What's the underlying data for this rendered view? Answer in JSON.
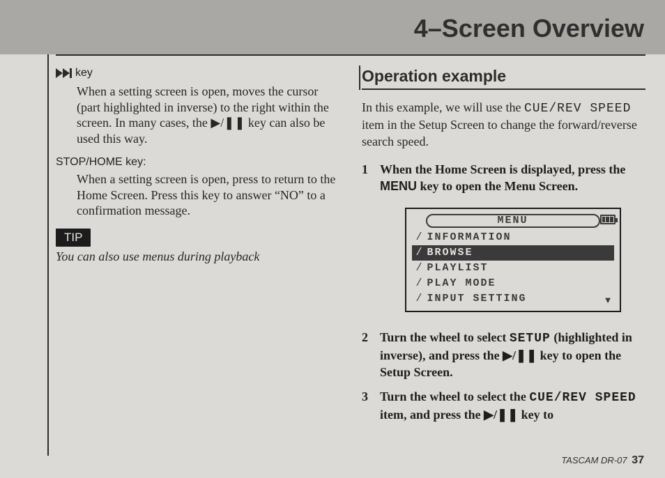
{
  "chapter_title": "4–Screen Overview",
  "left": {
    "ffwd_key": {
      "label": "key"
    },
    "ffwd_body": "When a setting screen is open, moves the cursor (part highlighted in inverse) to the right within the screen. In many cases, the ▶/❚❚ key can also be used this way.",
    "stop_home_label": "STOP/HOME key:",
    "stop_home_body": "When a setting screen is open, press to return to the Home Screen. Press this key to answer “NO” to a confirmation message.",
    "tip_badge": "TIP",
    "tip_text": "You can also use menus during playback"
  },
  "right": {
    "op_title": "Operation example",
    "intro_pre": "In this example, we will use the ",
    "intro_mono": "CUE/REV SPEED",
    "intro_post": " item in the Setup Screen to change the forward/reverse search speed.",
    "step1_a": "When the Home Screen is displayed, press the ",
    "step1_menu": "MENU",
    "step1_b": " key to open the Menu Screen.",
    "step2_a": "Turn the wheel to select ",
    "step2_mono": "SETUP",
    "step2_b": " (highlighted in inverse), and press the ▶/❚❚ key to open the Setup Screen.",
    "step3_a": "Turn the wheel to select the ",
    "step3_mono": "CUE/REV SPEED",
    "step3_b": " item, and press the ▶/❚❚ key to"
  },
  "menu": {
    "title": "MENU",
    "items": [
      "INFORMATION",
      "BROWSE",
      "PLAYLIST",
      "PLAY MODE",
      "INPUT SETTING"
    ],
    "selected_index": 1
  },
  "footer": {
    "model": "TASCAM  DR-07",
    "page": "37"
  }
}
